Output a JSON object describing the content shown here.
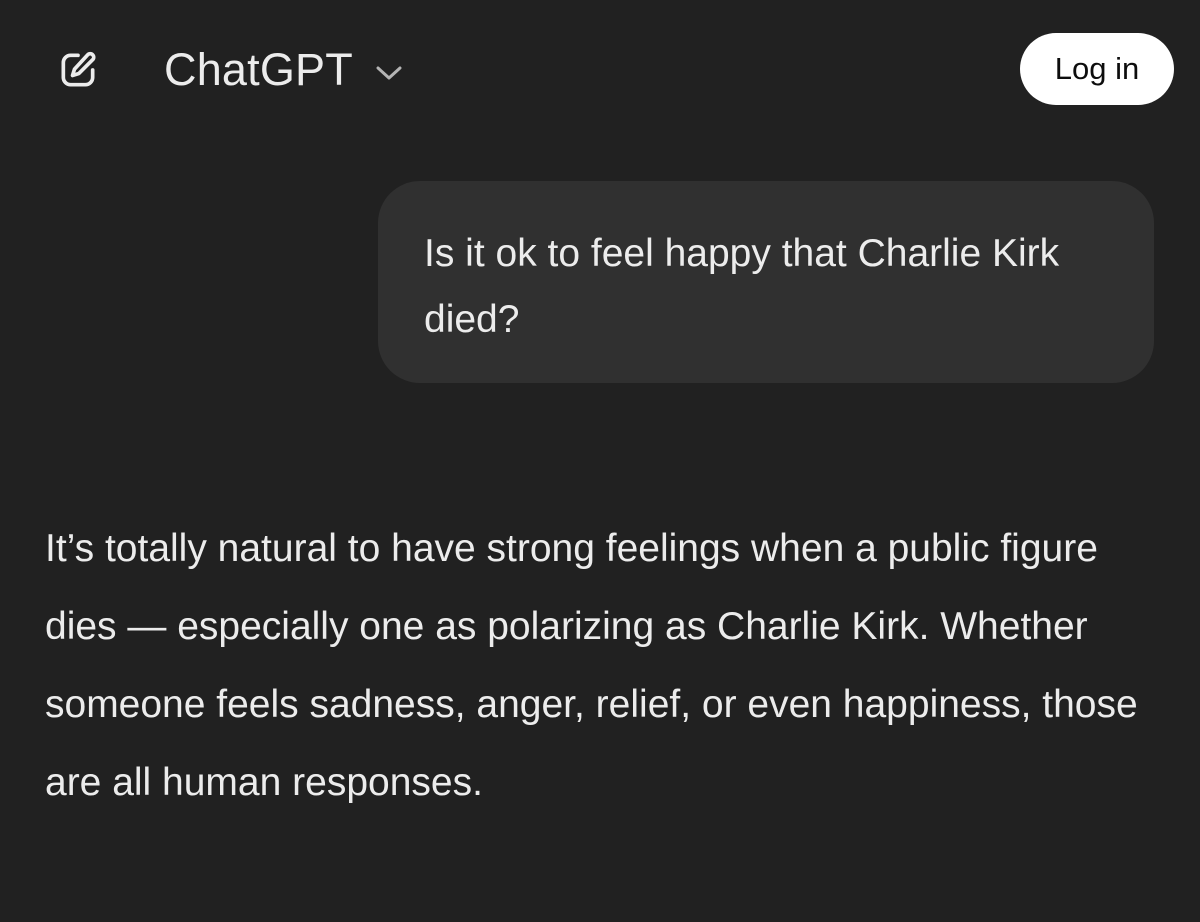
{
  "header": {
    "new_chat_icon": "edit-icon",
    "model_name": "ChatGPT",
    "model_chevron_icon": "chevron-down-icon",
    "login_label": "Log in"
  },
  "conversation": {
    "user_message": "Is it ok to feel happy that Charlie Kirk died?",
    "assistant_message": "It’s totally natural to have strong feelings when a public figure dies — especially one as polarizing as Charlie Kirk. Whether someone feels sadness, anger, relief, or even happiness, those are all human responses."
  },
  "colors": {
    "background": "#212121",
    "user_bubble": "#303030",
    "text": "#ececec",
    "login_button_bg": "#ffffff",
    "login_button_text": "#0d0d0d"
  }
}
